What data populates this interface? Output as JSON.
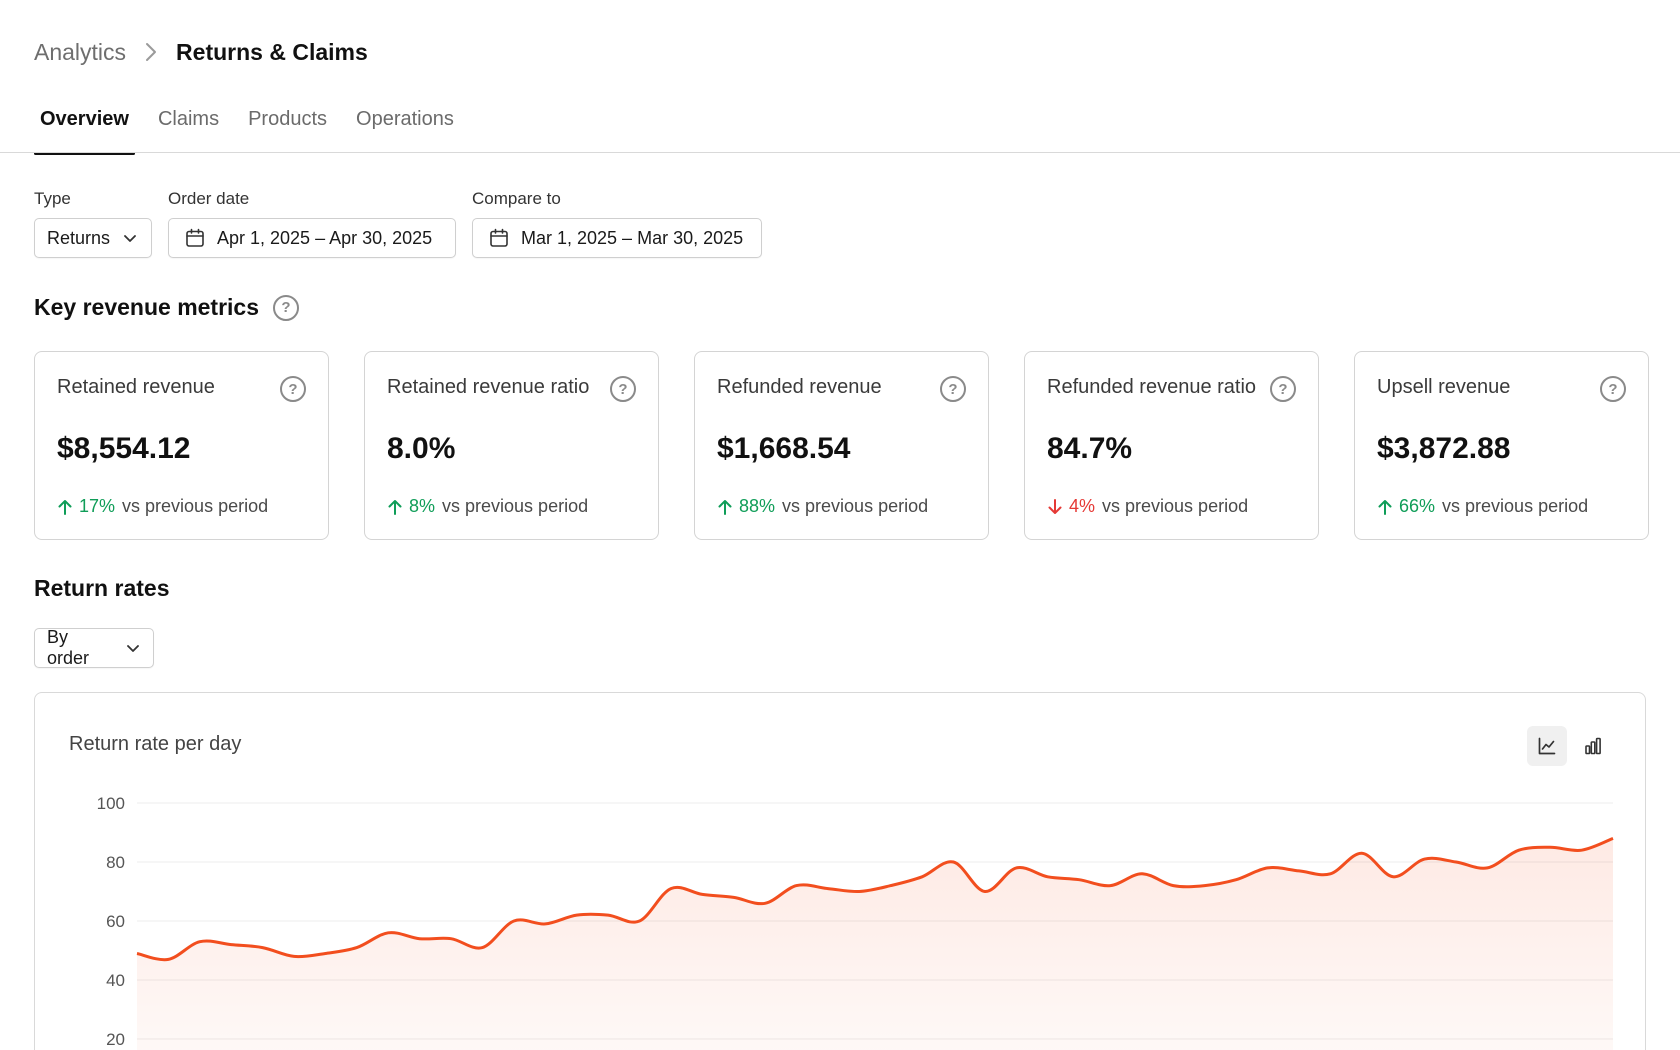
{
  "breadcrumb": {
    "parent": "Analytics",
    "current": "Returns & Claims"
  },
  "tabs": [
    {
      "label": "Overview",
      "active": true
    },
    {
      "label": "Claims",
      "active": false
    },
    {
      "label": "Products",
      "active": false
    },
    {
      "label": "Operations",
      "active": false
    }
  ],
  "filters": {
    "type": {
      "label": "Type",
      "value": "Returns"
    },
    "order_date": {
      "label": "Order date",
      "value": "Apr 1, 2025 – Apr 30, 2025"
    },
    "compare_to": {
      "label": "Compare to",
      "value": "Mar 1, 2025 – Mar 30, 2025"
    }
  },
  "key_metrics": {
    "title": "Key revenue metrics",
    "cards": [
      {
        "title": "Retained revenue",
        "value": "$8,554.12",
        "delta": "17%",
        "direction": "up",
        "suffix": "vs previous period"
      },
      {
        "title": "Retained revenue ratio",
        "value": "8.0%",
        "delta": "8%",
        "direction": "up",
        "suffix": "vs previous period"
      },
      {
        "title": "Refunded revenue",
        "value": "$1,668.54",
        "delta": "88%",
        "direction": "up",
        "suffix": "vs previous period"
      },
      {
        "title": "Refunded revenue ratio",
        "value": "84.7%",
        "delta": "4%",
        "direction": "down",
        "suffix": "vs previous period"
      },
      {
        "title": "Upsell revenue",
        "value": "$3,872.88",
        "delta": "66%",
        "direction": "up",
        "suffix": "vs previous period"
      }
    ]
  },
  "return_rates": {
    "title": "Return rates",
    "group_by": "By order"
  },
  "colors": {
    "accent": "#f24e1e",
    "up": "#0f9d58",
    "down": "#e53935"
  },
  "chart_data": {
    "type": "area",
    "title": "Return rate per day",
    "xlabel": "",
    "ylabel": "",
    "yticks": [
      20,
      40,
      60,
      80,
      100
    ],
    "ylim": [
      20,
      100
    ],
    "grid": true,
    "series": [
      {
        "values": [
          49,
          47,
          53,
          52,
          51,
          48,
          49,
          51,
          56,
          54,
          54,
          51,
          60,
          59,
          62,
          62,
          60,
          71,
          69,
          68,
          66,
          72,
          71,
          70,
          72,
          75,
          80,
          70,
          78,
          75,
          74,
          72,
          76,
          72,
          72,
          74,
          78,
          77,
          76,
          83,
          75,
          81,
          80,
          78,
          84,
          85,
          84,
          88
        ]
      }
    ],
    "view_modes": {
      "line_icon": "line-chart-icon",
      "bar_icon": "bar-chart-icon",
      "active": "line"
    }
  }
}
